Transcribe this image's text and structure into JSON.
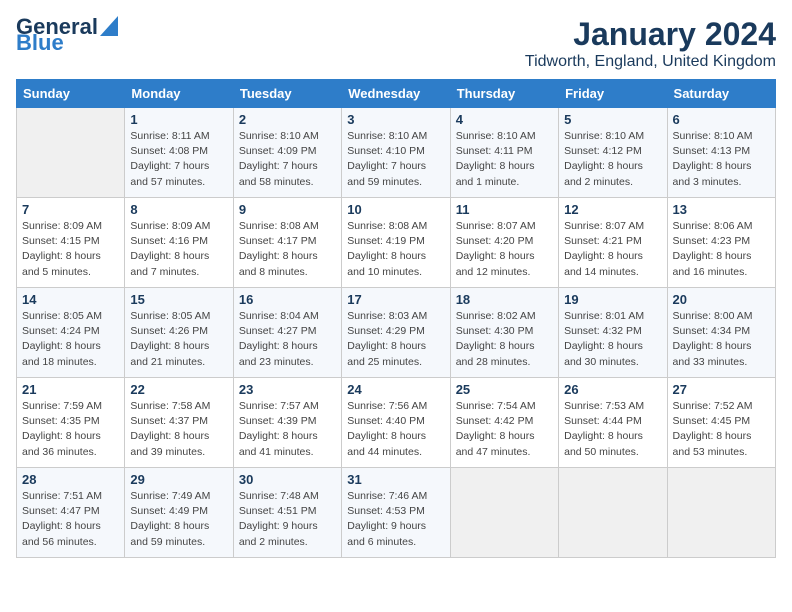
{
  "header": {
    "logo_line1": "General",
    "logo_line2": "Blue",
    "month_title": "January 2024",
    "location": "Tidworth, England, United Kingdom"
  },
  "days_of_week": [
    "Sunday",
    "Monday",
    "Tuesday",
    "Wednesday",
    "Thursday",
    "Friday",
    "Saturday"
  ],
  "weeks": [
    [
      {
        "day": "",
        "info": ""
      },
      {
        "day": "1",
        "info": "Sunrise: 8:11 AM\nSunset: 4:08 PM\nDaylight: 7 hours\nand 57 minutes."
      },
      {
        "day": "2",
        "info": "Sunrise: 8:10 AM\nSunset: 4:09 PM\nDaylight: 7 hours\nand 58 minutes."
      },
      {
        "day": "3",
        "info": "Sunrise: 8:10 AM\nSunset: 4:10 PM\nDaylight: 7 hours\nand 59 minutes."
      },
      {
        "day": "4",
        "info": "Sunrise: 8:10 AM\nSunset: 4:11 PM\nDaylight: 8 hours\nand 1 minute."
      },
      {
        "day": "5",
        "info": "Sunrise: 8:10 AM\nSunset: 4:12 PM\nDaylight: 8 hours\nand 2 minutes."
      },
      {
        "day": "6",
        "info": "Sunrise: 8:10 AM\nSunset: 4:13 PM\nDaylight: 8 hours\nand 3 minutes."
      }
    ],
    [
      {
        "day": "7",
        "info": "Sunrise: 8:09 AM\nSunset: 4:15 PM\nDaylight: 8 hours\nand 5 minutes."
      },
      {
        "day": "8",
        "info": "Sunrise: 8:09 AM\nSunset: 4:16 PM\nDaylight: 8 hours\nand 7 minutes."
      },
      {
        "day": "9",
        "info": "Sunrise: 8:08 AM\nSunset: 4:17 PM\nDaylight: 8 hours\nand 8 minutes."
      },
      {
        "day": "10",
        "info": "Sunrise: 8:08 AM\nSunset: 4:19 PM\nDaylight: 8 hours\nand 10 minutes."
      },
      {
        "day": "11",
        "info": "Sunrise: 8:07 AM\nSunset: 4:20 PM\nDaylight: 8 hours\nand 12 minutes."
      },
      {
        "day": "12",
        "info": "Sunrise: 8:07 AM\nSunset: 4:21 PM\nDaylight: 8 hours\nand 14 minutes."
      },
      {
        "day": "13",
        "info": "Sunrise: 8:06 AM\nSunset: 4:23 PM\nDaylight: 8 hours\nand 16 minutes."
      }
    ],
    [
      {
        "day": "14",
        "info": "Sunrise: 8:05 AM\nSunset: 4:24 PM\nDaylight: 8 hours\nand 18 minutes."
      },
      {
        "day": "15",
        "info": "Sunrise: 8:05 AM\nSunset: 4:26 PM\nDaylight: 8 hours\nand 21 minutes."
      },
      {
        "day": "16",
        "info": "Sunrise: 8:04 AM\nSunset: 4:27 PM\nDaylight: 8 hours\nand 23 minutes."
      },
      {
        "day": "17",
        "info": "Sunrise: 8:03 AM\nSunset: 4:29 PM\nDaylight: 8 hours\nand 25 minutes."
      },
      {
        "day": "18",
        "info": "Sunrise: 8:02 AM\nSunset: 4:30 PM\nDaylight: 8 hours\nand 28 minutes."
      },
      {
        "day": "19",
        "info": "Sunrise: 8:01 AM\nSunset: 4:32 PM\nDaylight: 8 hours\nand 30 minutes."
      },
      {
        "day": "20",
        "info": "Sunrise: 8:00 AM\nSunset: 4:34 PM\nDaylight: 8 hours\nand 33 minutes."
      }
    ],
    [
      {
        "day": "21",
        "info": "Sunrise: 7:59 AM\nSunset: 4:35 PM\nDaylight: 8 hours\nand 36 minutes."
      },
      {
        "day": "22",
        "info": "Sunrise: 7:58 AM\nSunset: 4:37 PM\nDaylight: 8 hours\nand 39 minutes."
      },
      {
        "day": "23",
        "info": "Sunrise: 7:57 AM\nSunset: 4:39 PM\nDaylight: 8 hours\nand 41 minutes."
      },
      {
        "day": "24",
        "info": "Sunrise: 7:56 AM\nSunset: 4:40 PM\nDaylight: 8 hours\nand 44 minutes."
      },
      {
        "day": "25",
        "info": "Sunrise: 7:54 AM\nSunset: 4:42 PM\nDaylight: 8 hours\nand 47 minutes."
      },
      {
        "day": "26",
        "info": "Sunrise: 7:53 AM\nSunset: 4:44 PM\nDaylight: 8 hours\nand 50 minutes."
      },
      {
        "day": "27",
        "info": "Sunrise: 7:52 AM\nSunset: 4:45 PM\nDaylight: 8 hours\nand 53 minutes."
      }
    ],
    [
      {
        "day": "28",
        "info": "Sunrise: 7:51 AM\nSunset: 4:47 PM\nDaylight: 8 hours\nand 56 minutes."
      },
      {
        "day": "29",
        "info": "Sunrise: 7:49 AM\nSunset: 4:49 PM\nDaylight: 8 hours\nand 59 minutes."
      },
      {
        "day": "30",
        "info": "Sunrise: 7:48 AM\nSunset: 4:51 PM\nDaylight: 9 hours\nand 2 minutes."
      },
      {
        "day": "31",
        "info": "Sunrise: 7:46 AM\nSunset: 4:53 PM\nDaylight: 9 hours\nand 6 minutes."
      },
      {
        "day": "",
        "info": ""
      },
      {
        "day": "",
        "info": ""
      },
      {
        "day": "",
        "info": ""
      }
    ]
  ]
}
